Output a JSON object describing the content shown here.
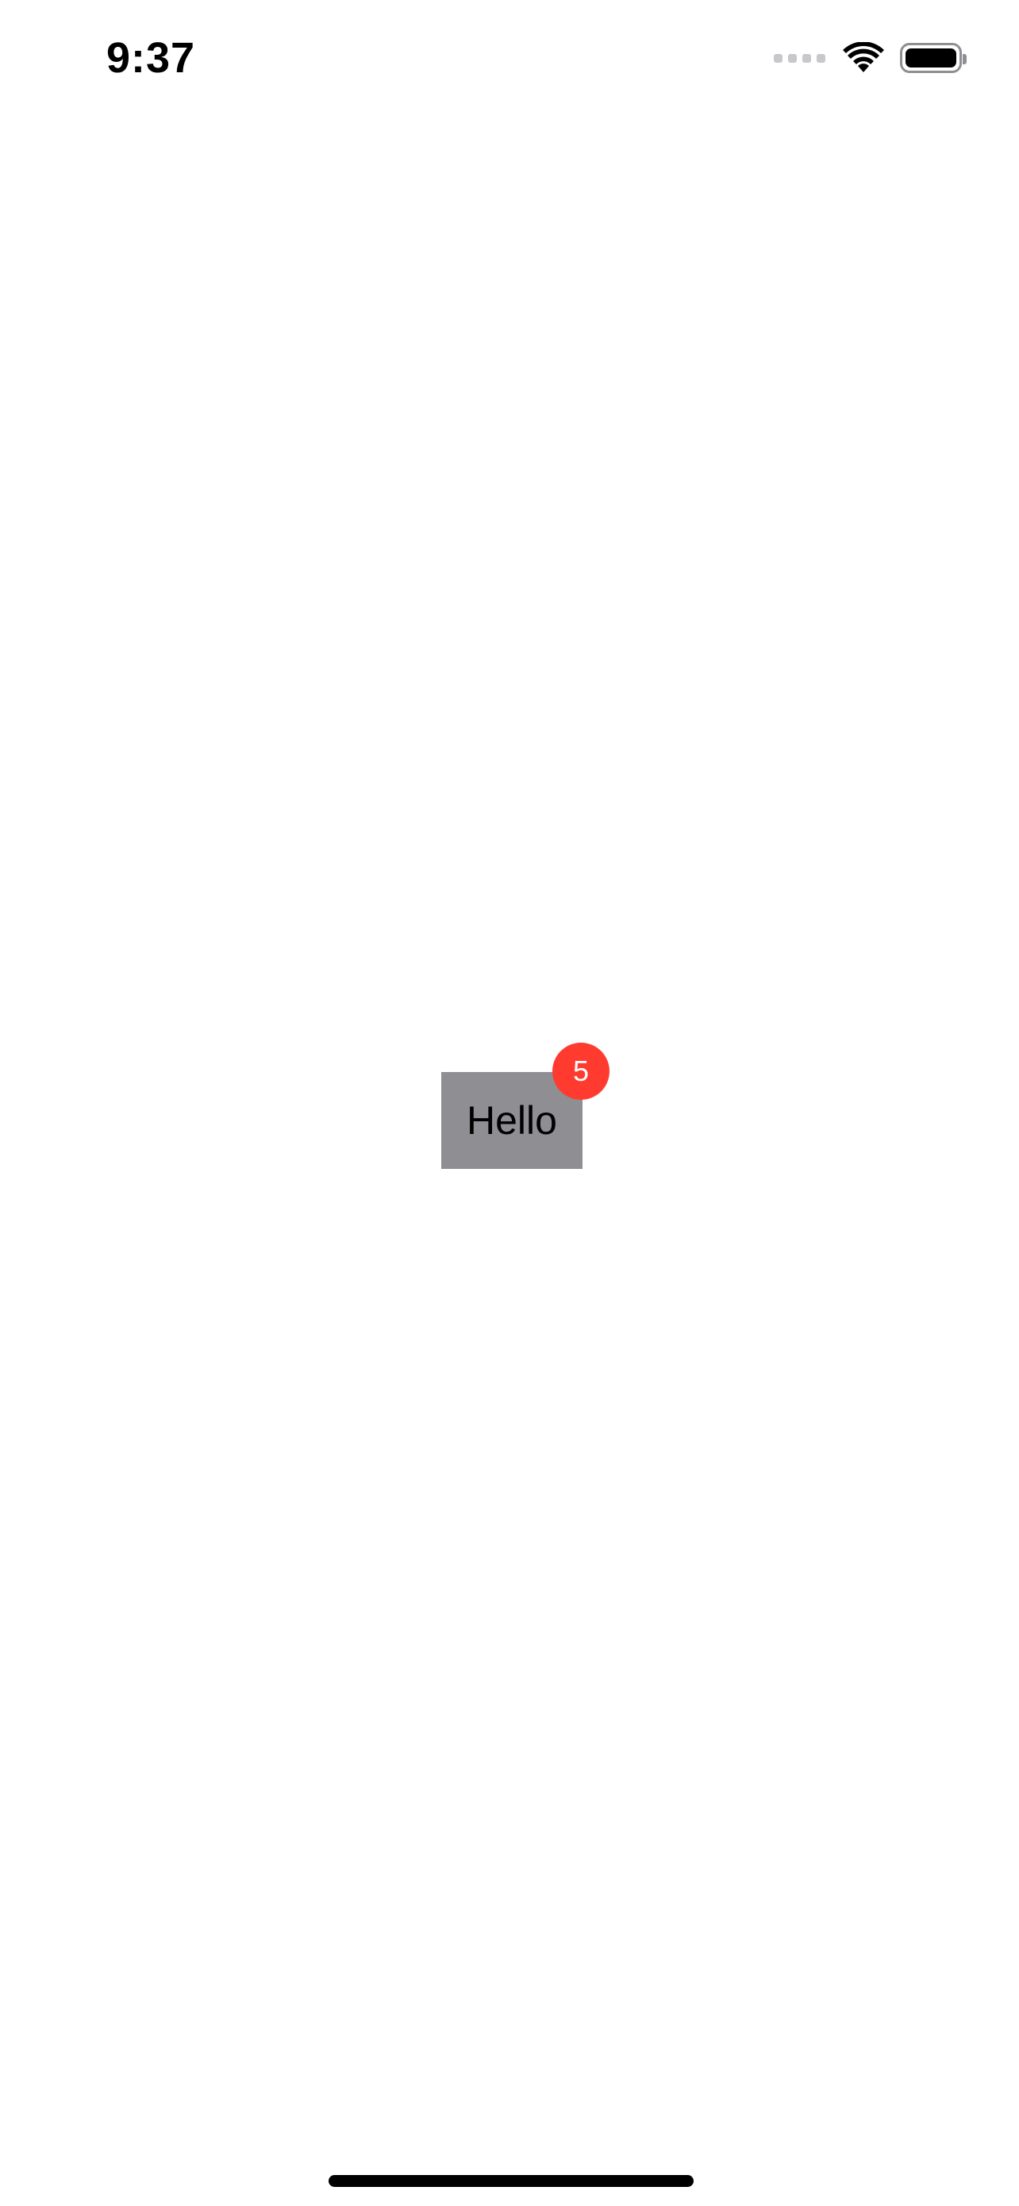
{
  "status_bar": {
    "time": "9:37",
    "icons": [
      "cellular-signal-icon",
      "wifi-icon",
      "battery-icon"
    ]
  },
  "main": {
    "button_label": "Hello",
    "badge_count": "5"
  },
  "colors": {
    "button_background": "#8e8e93",
    "badge_background": "#ff3b30",
    "badge_text": "#ffffff",
    "page_background": "#ffffff"
  }
}
